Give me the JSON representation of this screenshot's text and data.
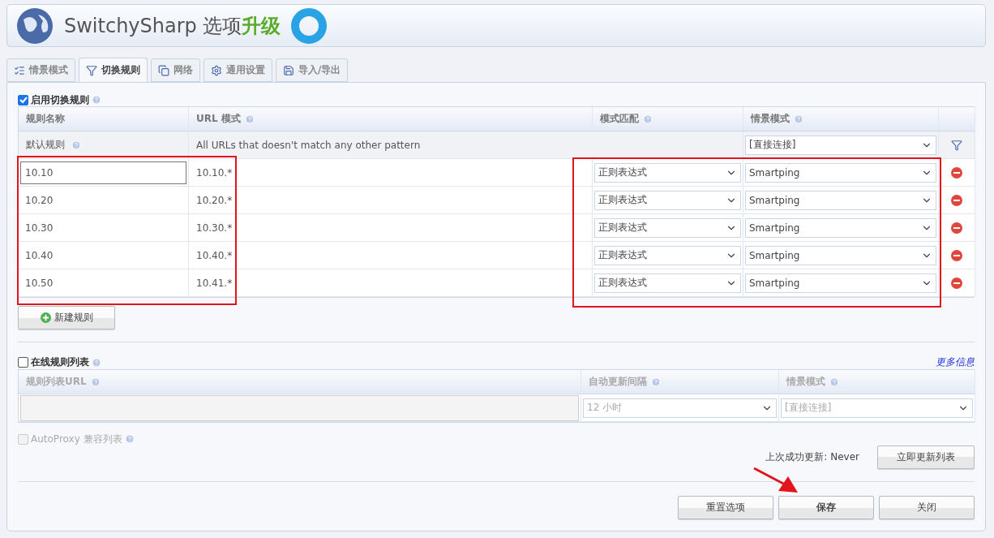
{
  "header": {
    "title": "SwitchySharp 选项",
    "upgrade": "升级"
  },
  "tabs": [
    {
      "label": "情景模式",
      "selected": false
    },
    {
      "label": "切换规则",
      "selected": true
    },
    {
      "label": "网络",
      "selected": false
    },
    {
      "label": "通用设置",
      "selected": false
    },
    {
      "label": "导入/导出",
      "selected": false
    }
  ],
  "rules_section": {
    "label": "启用切换规则",
    "checked": true,
    "columns": [
      "规则名称",
      "URL 模式",
      "模式匹配",
      "情景模式"
    ],
    "default_rule": {
      "name": "默认规则",
      "pattern": "All URLs that doesn't match any other pattern",
      "profile": "[直接连接]"
    },
    "rules": [
      {
        "name": "10.10",
        "pattern": "10.10.*",
        "match": "正则表达式",
        "profile": "Smartping",
        "focused": true
      },
      {
        "name": "10.20",
        "pattern": "10.20.*",
        "match": "正则表达式",
        "profile": "Smartping",
        "focused": false
      },
      {
        "name": "10.30",
        "pattern": "10.30.*",
        "match": "正则表达式",
        "profile": "Smartping",
        "focused": false
      },
      {
        "name": "10.40",
        "pattern": "10.40.*",
        "match": "正则表达式",
        "profile": "Smartping",
        "focused": false
      },
      {
        "name": "10.50",
        "pattern": "10.41.*",
        "match": "正则表达式",
        "profile": "Smartping",
        "focused": false
      }
    ],
    "new_rule_button": "新建规则"
  },
  "online_section": {
    "label": "在线规则列表",
    "checked": false,
    "more_info": "更多信息",
    "columns": [
      "规则列表URL",
      "自动更新间隔",
      "情景模式"
    ],
    "interval": "12 小时",
    "profile": "[直接连接]",
    "autoproxy": {
      "label": "AutoProxy 兼容列表",
      "checked": false,
      "disabled": true
    },
    "last_update": "上次成功更新: Never",
    "update_button": "立即更新列表"
  },
  "footer_buttons": [
    {
      "label": "重置选项",
      "primary": false
    },
    {
      "label": "保存",
      "primary": true
    },
    {
      "label": "关闭",
      "primary": false
    }
  ]
}
